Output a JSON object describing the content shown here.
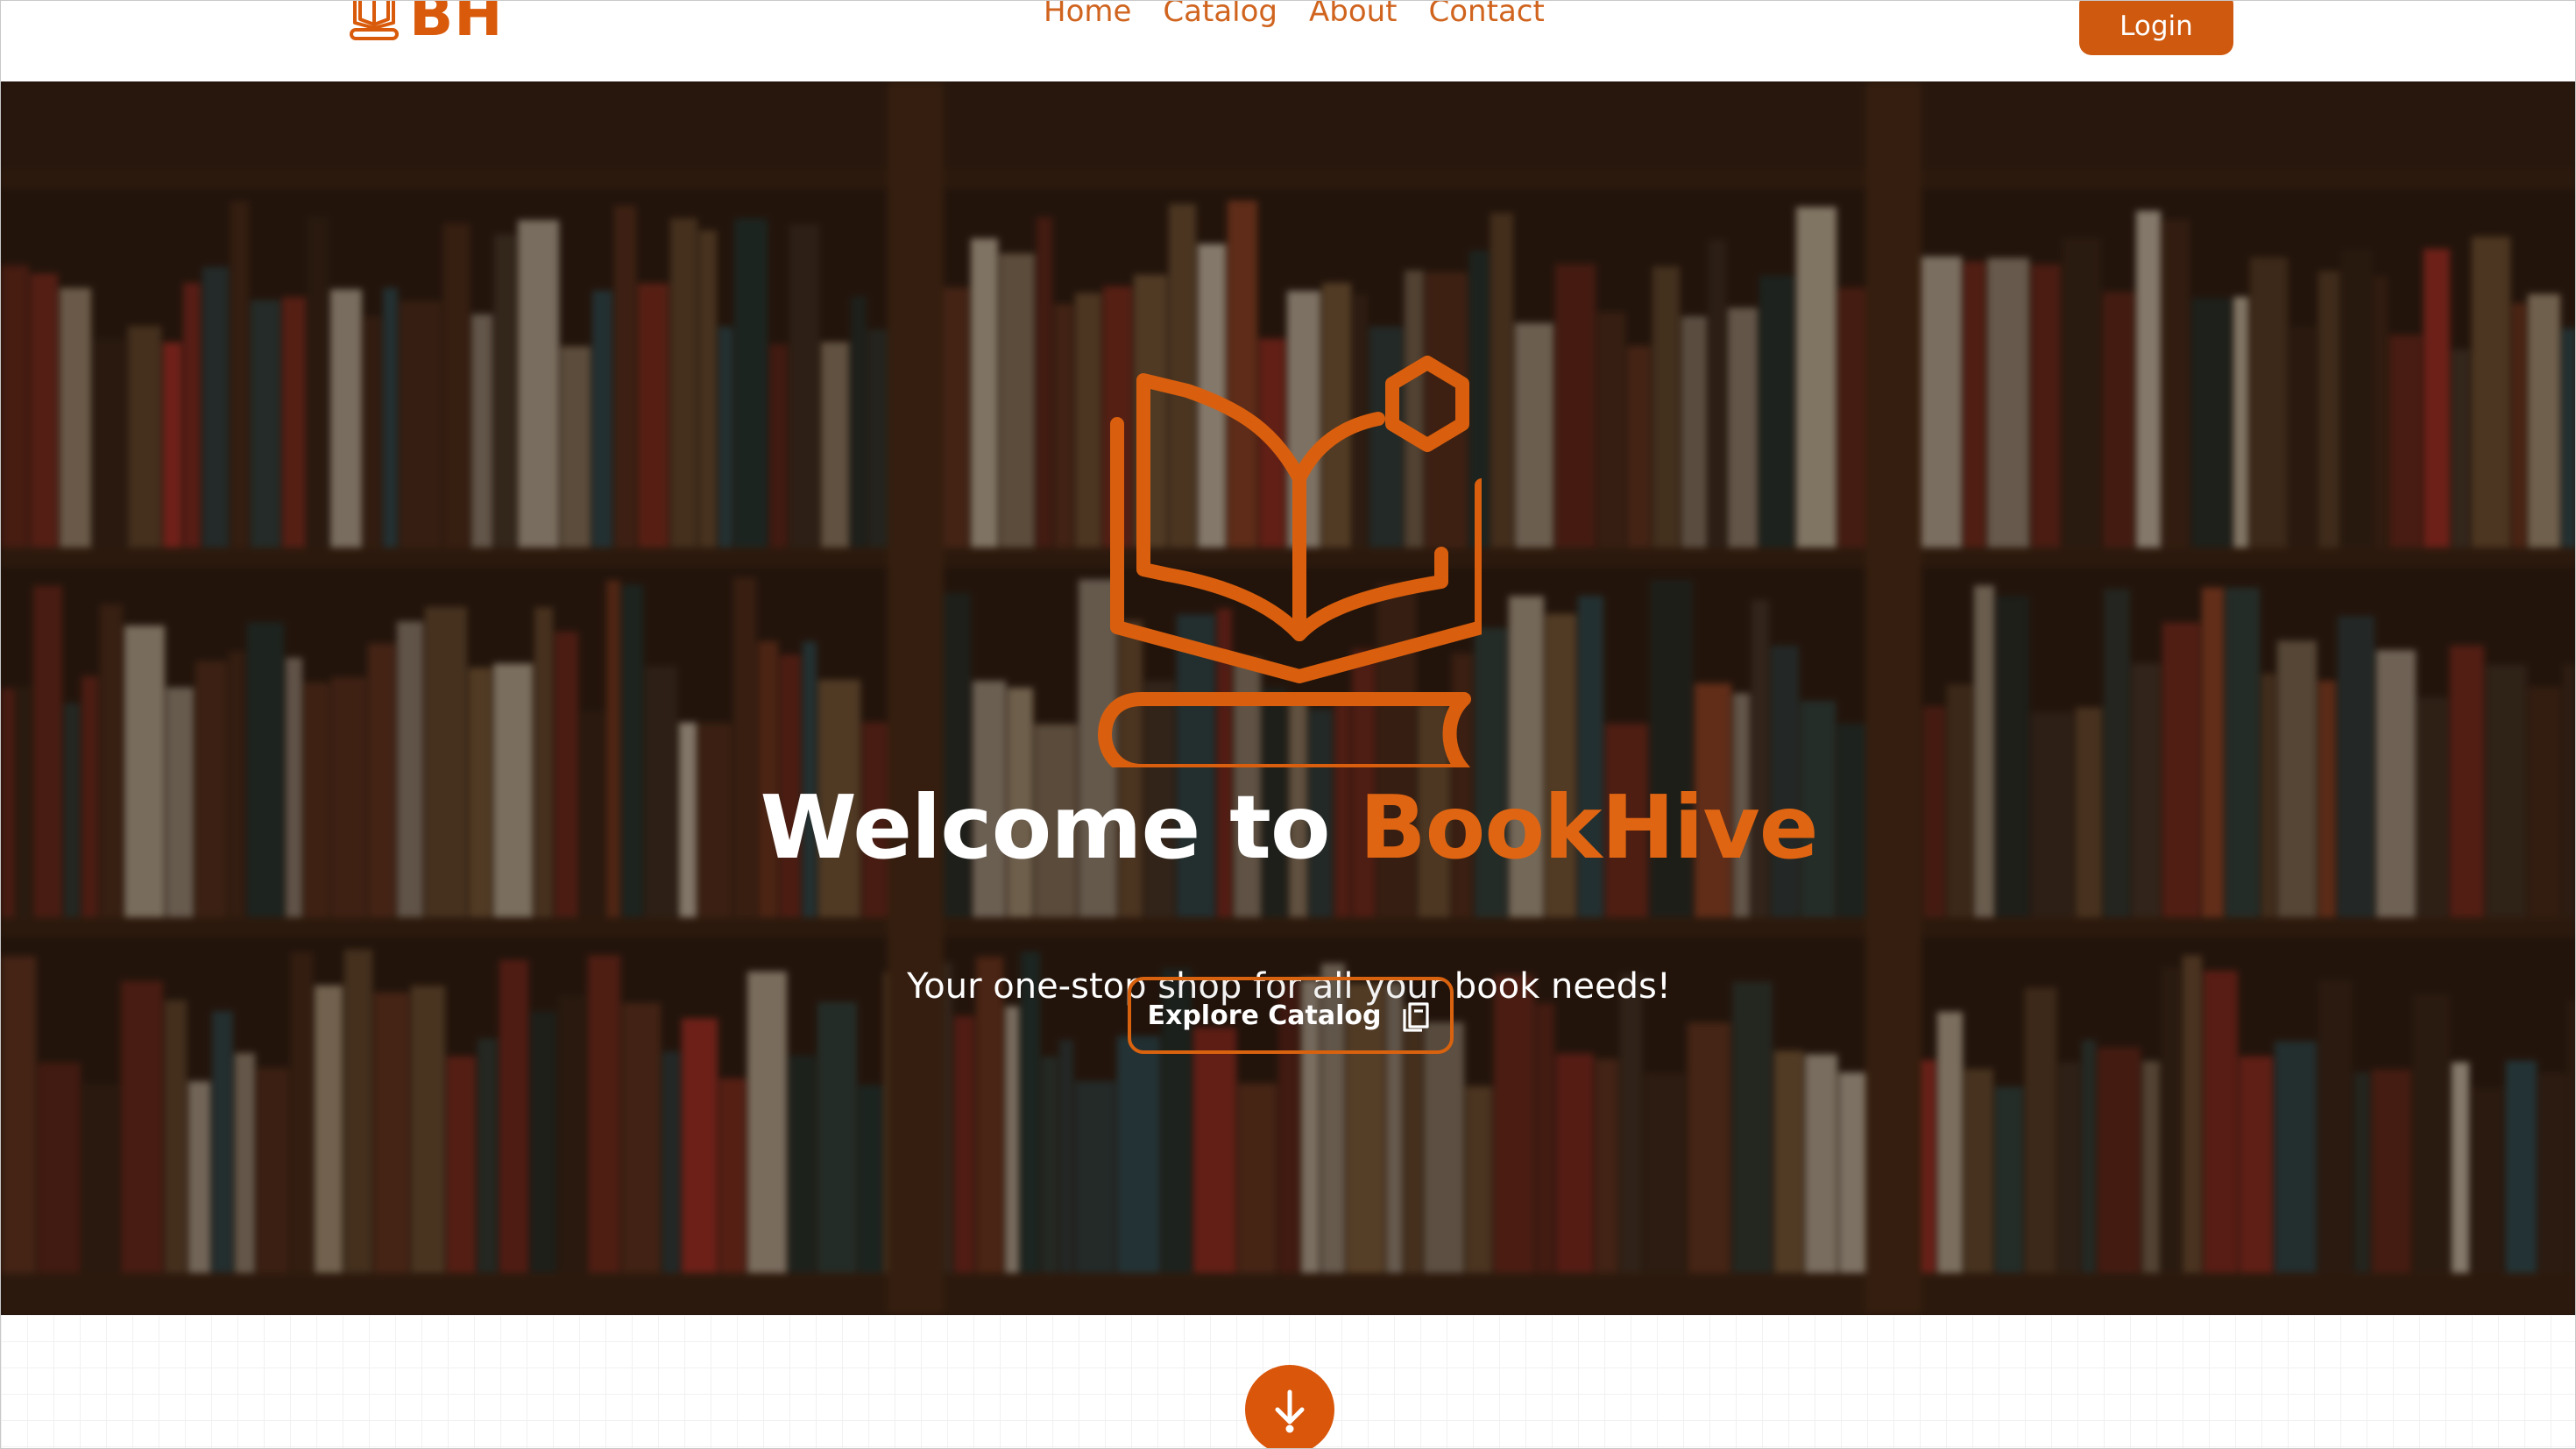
{
  "page": {
    "title": "BookHive"
  },
  "header": {
    "logo_text": "BH",
    "logo_icon": "book-stack-icon",
    "nav": [
      {
        "label": "Home"
      },
      {
        "label": "Catalog"
      },
      {
        "label": "About"
      },
      {
        "label": "Contact"
      }
    ],
    "login_label": "Login"
  },
  "hero": {
    "background": "blurred-bookshelf-photo",
    "icon": "open-book-hexagon-icon",
    "title_prefix": "Welcome to",
    "title_brand": "BookHive",
    "subtitle": "Your one-stop shop for all your book needs!",
    "cta_label": "Explore Catalog",
    "cta_icon": "copy-icon"
  },
  "scroll": {
    "icon": "arrow-down-icon"
  },
  "colors": {
    "accent": "#d85a0a",
    "button": "#cf5a0f",
    "hero_overlay": "#190c05",
    "text_light": "#ffffff"
  }
}
